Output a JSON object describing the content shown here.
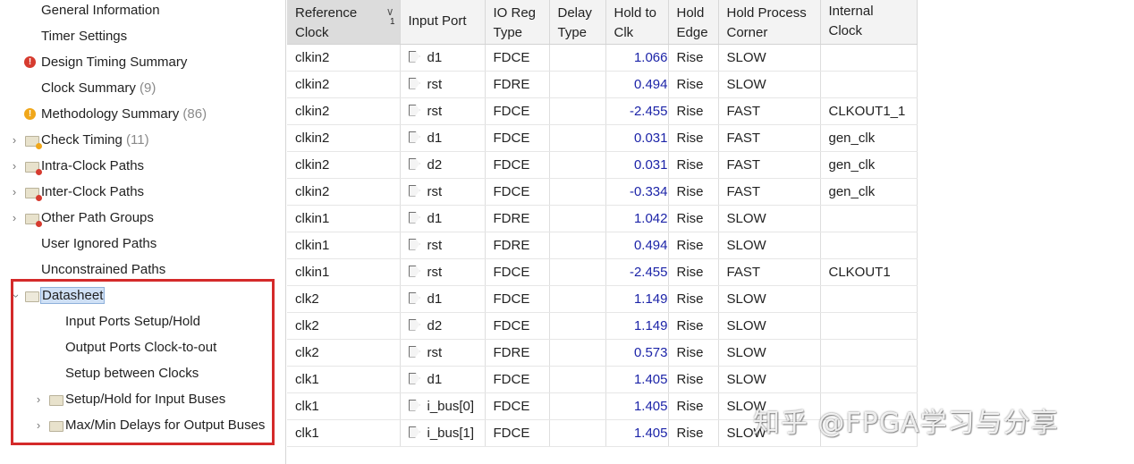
{
  "tree": {
    "general_information": "General Information",
    "timer_settings": "Timer Settings",
    "design_timing_summary": "Design Timing Summary",
    "clock_summary": "Clock Summary",
    "clock_summary_count": "(9)",
    "methodology_summary": "Methodology Summary",
    "methodology_summary_count": "(86)",
    "check_timing": "Check Timing",
    "check_timing_count": "(11)",
    "intra_clock_paths": "Intra-Clock Paths",
    "inter_clock_paths": "Inter-Clock Paths",
    "other_path_groups": "Other Path Groups",
    "user_ignored_paths": "User Ignored Paths",
    "unconstrained_paths": "Unconstrained Paths",
    "datasheet": "Datasheet",
    "input_ports_setup_hold": "Input Ports Setup/Hold",
    "output_ports_clock_to_out": "Output Ports Clock-to-out",
    "setup_between_clocks": "Setup between Clocks",
    "setup_hold_input_buses": "Setup/Hold for Input Buses",
    "max_min_delays_output_buses": "Max/Min Delays for Output Buses"
  },
  "table": {
    "headers": {
      "reference_clock": "Reference Clock",
      "sort_index": "1",
      "input_port": "Input Port",
      "io_reg_type": "IO Reg Type",
      "delay_type": "Delay Type",
      "hold_to_clk": "Hold to Clk",
      "hold_edge": "Hold Edge",
      "hold_process_corner": "Hold Process Corner",
      "internal_clock": "Internal Clock"
    },
    "rows": [
      {
        "ref": "clkin2",
        "port": "d1",
        "reg": "FDCE",
        "delay": "",
        "hold": "1.066",
        "edge": "Rise",
        "corner": "SLOW",
        "internal": ""
      },
      {
        "ref": "clkin2",
        "port": "rst",
        "reg": "FDRE",
        "delay": "",
        "hold": "0.494",
        "edge": "Rise",
        "corner": "SLOW",
        "internal": ""
      },
      {
        "ref": "clkin2",
        "port": "rst",
        "reg": "FDCE",
        "delay": "",
        "hold": "-2.455",
        "edge": "Rise",
        "corner": "FAST",
        "internal": "CLKOUT1_1"
      },
      {
        "ref": "clkin2",
        "port": "d1",
        "reg": "FDCE",
        "delay": "",
        "hold": "0.031",
        "edge": "Rise",
        "corner": "FAST",
        "internal": "gen_clk"
      },
      {
        "ref": "clkin2",
        "port": "d2",
        "reg": "FDCE",
        "delay": "",
        "hold": "0.031",
        "edge": "Rise",
        "corner": "FAST",
        "internal": "gen_clk"
      },
      {
        "ref": "clkin2",
        "port": "rst",
        "reg": "FDCE",
        "delay": "",
        "hold": "-0.334",
        "edge": "Rise",
        "corner": "FAST",
        "internal": "gen_clk"
      },
      {
        "ref": "clkin1",
        "port": "d1",
        "reg": "FDRE",
        "delay": "",
        "hold": "1.042",
        "edge": "Rise",
        "corner": "SLOW",
        "internal": ""
      },
      {
        "ref": "clkin1",
        "port": "rst",
        "reg": "FDRE",
        "delay": "",
        "hold": "0.494",
        "edge": "Rise",
        "corner": "SLOW",
        "internal": ""
      },
      {
        "ref": "clkin1",
        "port": "rst",
        "reg": "FDCE",
        "delay": "",
        "hold": "-2.455",
        "edge": "Rise",
        "corner": "FAST",
        "internal": "CLKOUT1"
      },
      {
        "ref": "clk2",
        "port": "d1",
        "reg": "FDCE",
        "delay": "",
        "hold": "1.149",
        "edge": "Rise",
        "corner": "SLOW",
        "internal": ""
      },
      {
        "ref": "clk2",
        "port": "d2",
        "reg": "FDCE",
        "delay": "",
        "hold": "1.149",
        "edge": "Rise",
        "corner": "SLOW",
        "internal": ""
      },
      {
        "ref": "clk2",
        "port": "rst",
        "reg": "FDRE",
        "delay": "",
        "hold": "0.573",
        "edge": "Rise",
        "corner": "SLOW",
        "internal": ""
      },
      {
        "ref": "clk1",
        "port": "d1",
        "reg": "FDCE",
        "delay": "",
        "hold": "1.405",
        "edge": "Rise",
        "corner": "SLOW",
        "internal": ""
      },
      {
        "ref": "clk1",
        "port": "i_bus[0]",
        "reg": "FDCE",
        "delay": "",
        "hold": "1.405",
        "edge": "Rise",
        "corner": "SLOW",
        "internal": ""
      },
      {
        "ref": "clk1",
        "port": "i_bus[1]",
        "reg": "FDCE",
        "delay": "",
        "hold": "1.405",
        "edge": "Rise",
        "corner": "SLOW",
        "internal": ""
      }
    ]
  },
  "watermark": "知乎 @FPGA学习与分享",
  "colors": {
    "highlight_box": "#d42a2a",
    "numeric_value": "#1c24a8",
    "error_icon": "#d63b2f",
    "warning_icon": "#f0a71b",
    "selection_bg": "#cfe0f5"
  }
}
